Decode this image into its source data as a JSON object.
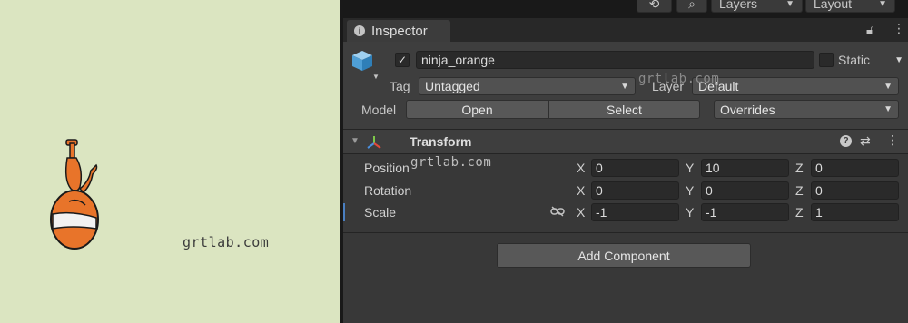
{
  "toolbar": {
    "layers_label": "Layers",
    "layout_label": "Layout"
  },
  "inspector": {
    "tab_label": "Inspector",
    "object": {
      "active": true,
      "name": "ninja_orange",
      "static_label": "Static",
      "static_checked": false,
      "tag_label": "Tag",
      "tag_value": "Untagged",
      "layer_label": "Layer",
      "layer_value": "Default",
      "model_label": "Model",
      "open_label": "Open",
      "select_label": "Select",
      "overrides_label": "Overrides"
    },
    "transform": {
      "title": "Transform",
      "position_label": "Position",
      "rotation_label": "Rotation",
      "scale_label": "Scale",
      "x_label": "X",
      "y_label": "Y",
      "z_label": "Z",
      "position": {
        "x": "0",
        "y": "10",
        "z": "0"
      },
      "rotation": {
        "x": "0",
        "y": "0",
        "z": "0"
      },
      "scale": {
        "x": "-1",
        "y": "-1",
        "z": "1"
      }
    },
    "add_component_label": "Add Component"
  },
  "watermark": "grtlab.com",
  "icons": {
    "history": "history-icon",
    "search": "search-icon",
    "info": "info-icon",
    "lock": "lock-icon",
    "prefab": "prefab-cube-icon",
    "transform": "transform-axes-icon",
    "help": "help-icon",
    "presets": "presets-icon",
    "menu": "kebab-menu-icon",
    "link": "link-icon"
  },
  "colors": {
    "scene_background": "#dbe5c1",
    "panel_background": "#383838",
    "field_background": "#2a2a2a",
    "character_orange": "#e8742a",
    "scale_marker": "#4a7fc1"
  }
}
